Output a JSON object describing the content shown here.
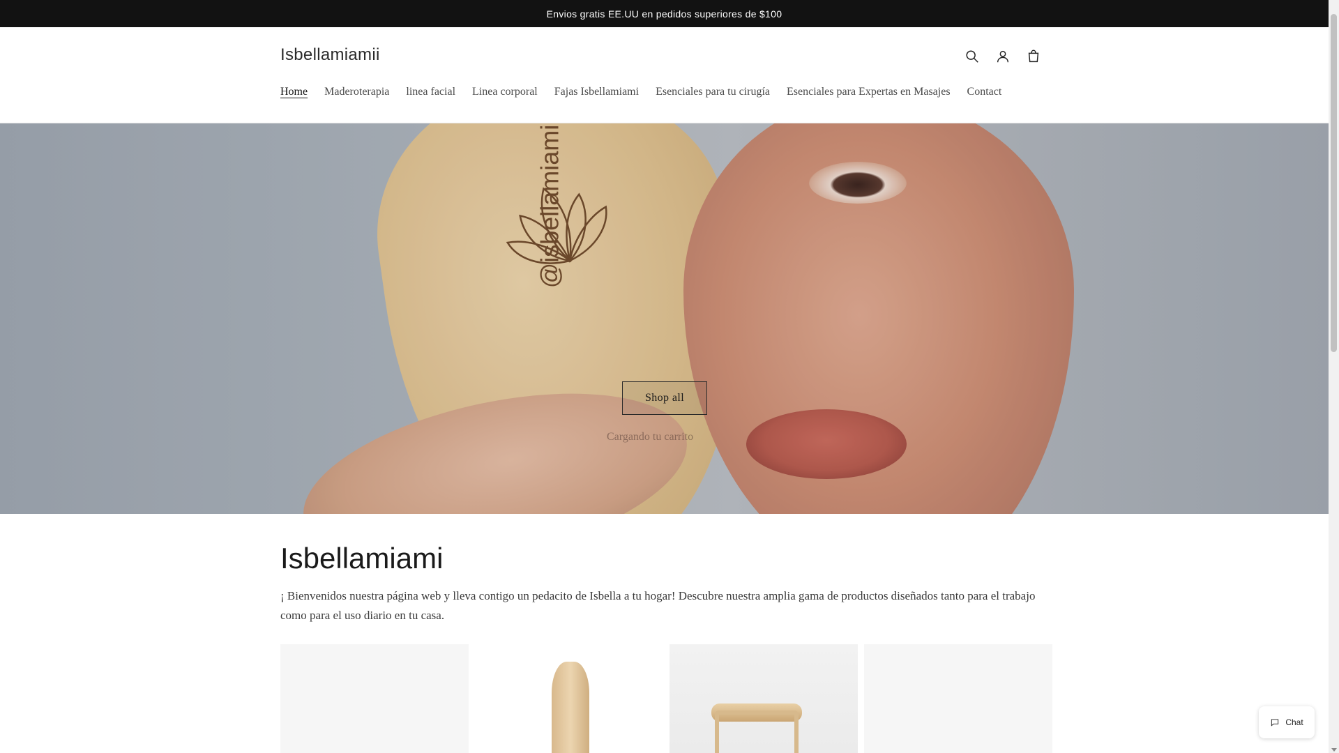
{
  "announcement": {
    "text": "Envios gratis EE.UU en pedidos superiores de $100"
  },
  "header": {
    "logo": "Isbellamiamii",
    "icons": [
      "search-icon",
      "account-icon",
      "cart-icon"
    ]
  },
  "nav": {
    "items": [
      {
        "label": "Home",
        "active": true
      },
      {
        "label": "Maderoterapia",
        "active": false
      },
      {
        "label": "linea facial",
        "active": false
      },
      {
        "label": "Linea corporal",
        "active": false
      },
      {
        "label": "Fajas Isbellamiami",
        "active": false
      },
      {
        "label": "Esenciales para tu cirugía",
        "active": false
      },
      {
        "label": "Esenciales para Expertas en Masajes",
        "active": false
      },
      {
        "label": "Contact",
        "active": false
      }
    ]
  },
  "hero": {
    "shop_button": "Shop all",
    "caption": "Cargando tu carrito",
    "product_logo_text": "@isbellamiami"
  },
  "intro": {
    "title": "Isbellamiami",
    "text": "¡ Bienvenidos nuestra página web y lleva contigo un pedacito de Isbella a tu hogar! Descubre nuestra amplia gama de productos diseñados tanto para el trabajo como para el uso diario en tu casa."
  },
  "chat": {
    "label": "Chat"
  },
  "colors": {
    "announcement_bg": "#121212",
    "accent_text": "#121212"
  }
}
